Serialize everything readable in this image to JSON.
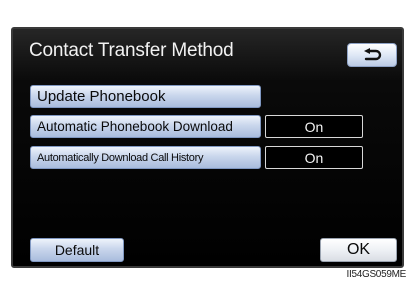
{
  "header": {
    "title": "Contact Transfer Method",
    "back_icon": "return-arrow-icon"
  },
  "menu": {
    "update_phonebook": "Update Phonebook",
    "rows": [
      {
        "label": "Automatic Phonebook Download",
        "value": "On"
      },
      {
        "label": "Automatically Download Call History",
        "value": "On"
      }
    ]
  },
  "footer": {
    "default_label": "Default",
    "ok_label": "OK"
  },
  "image_code": "II54GS059ME",
  "colors": {
    "screen_bg": "#000000",
    "button_blue": "#c9d6ec",
    "text_light": "#f2f2f2"
  }
}
